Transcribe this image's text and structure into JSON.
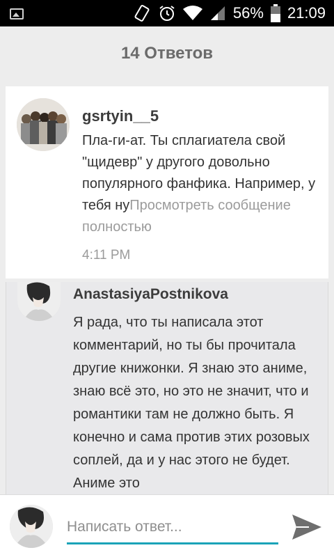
{
  "status_bar": {
    "battery_percent": "56%",
    "time": "21:09",
    "icons": [
      "gallery-icon",
      "vibrate-icon",
      "alarm-icon",
      "wifi-icon",
      "signal-icon",
      "battery-icon"
    ]
  },
  "header": {
    "title": "14 Ответов"
  },
  "comments": [
    {
      "author": "gsrtyin__5",
      "text": "Пла-ги-ат.  Ты сплагиатела свой \"щидевр\" у другого довольно популярного фанфика. Например, у тебя ну",
      "more_label": "Просмотреть сообщение полностью",
      "time": "4:11 PM"
    },
    {
      "author": "AnastasiyaPostnikova",
      "text": "Я рада, что ты написала этот комментарий, но ты бы прочитала другие книжонки. Я знаю это аниме, знаю всё это, но это не значит, что и романтики там не должно быть. Я конечно и сама против этих розовых соплей, да и у нас этого не будет. Аниме это"
    }
  ],
  "reply": {
    "placeholder": "Написать ответ...",
    "value": ""
  },
  "colors": {
    "accent": "#1aa3b8",
    "header_text": "#6b6b6b",
    "muted": "#9b9b9b"
  }
}
